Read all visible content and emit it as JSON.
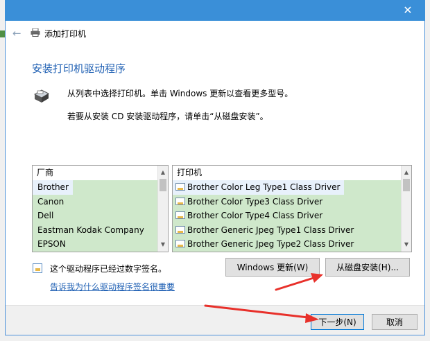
{
  "window": {
    "title": "添加打印机",
    "close_glyph": "✕"
  },
  "header": {
    "heading": "安装打印机驱动程序",
    "line1": "从列表中选择打印机。单击 Windows 更新以查看更多型号。",
    "line2": "若要从安装 CD 安装驱动程序，请单击“从磁盘安装”。"
  },
  "manufacturers": {
    "header": "厂商",
    "items": [
      "Brother",
      "Canon",
      "Dell",
      "Eastman Kodak Company",
      "EPSON"
    ]
  },
  "printers": {
    "header": "打印机",
    "items": [
      "Brother Color Leg Type1 Class Driver",
      "Brother Color Type3 Class Driver",
      "Brother Color Type4 Class Driver",
      "Brother Generic Jpeg Type1 Class Driver",
      "Brother Generic Jpeg Type2 Class Driver"
    ]
  },
  "signature": {
    "text": "这个驱动程序已经过数字签名。",
    "link": "告诉我为什么驱动程序签名很重要"
  },
  "buttons": {
    "windows_update": "Windows 更新(W)",
    "have_disk": "从磁盘安装(H)...",
    "next": "下一步(N)",
    "cancel": "取消"
  },
  "icons": {
    "back": "←",
    "scroll_up": "▲",
    "scroll_down": "▼"
  },
  "colors": {
    "accent": "#1e5fb3",
    "list_fill": "#cfe8cb",
    "annotation_arrow": "#e8302a"
  }
}
